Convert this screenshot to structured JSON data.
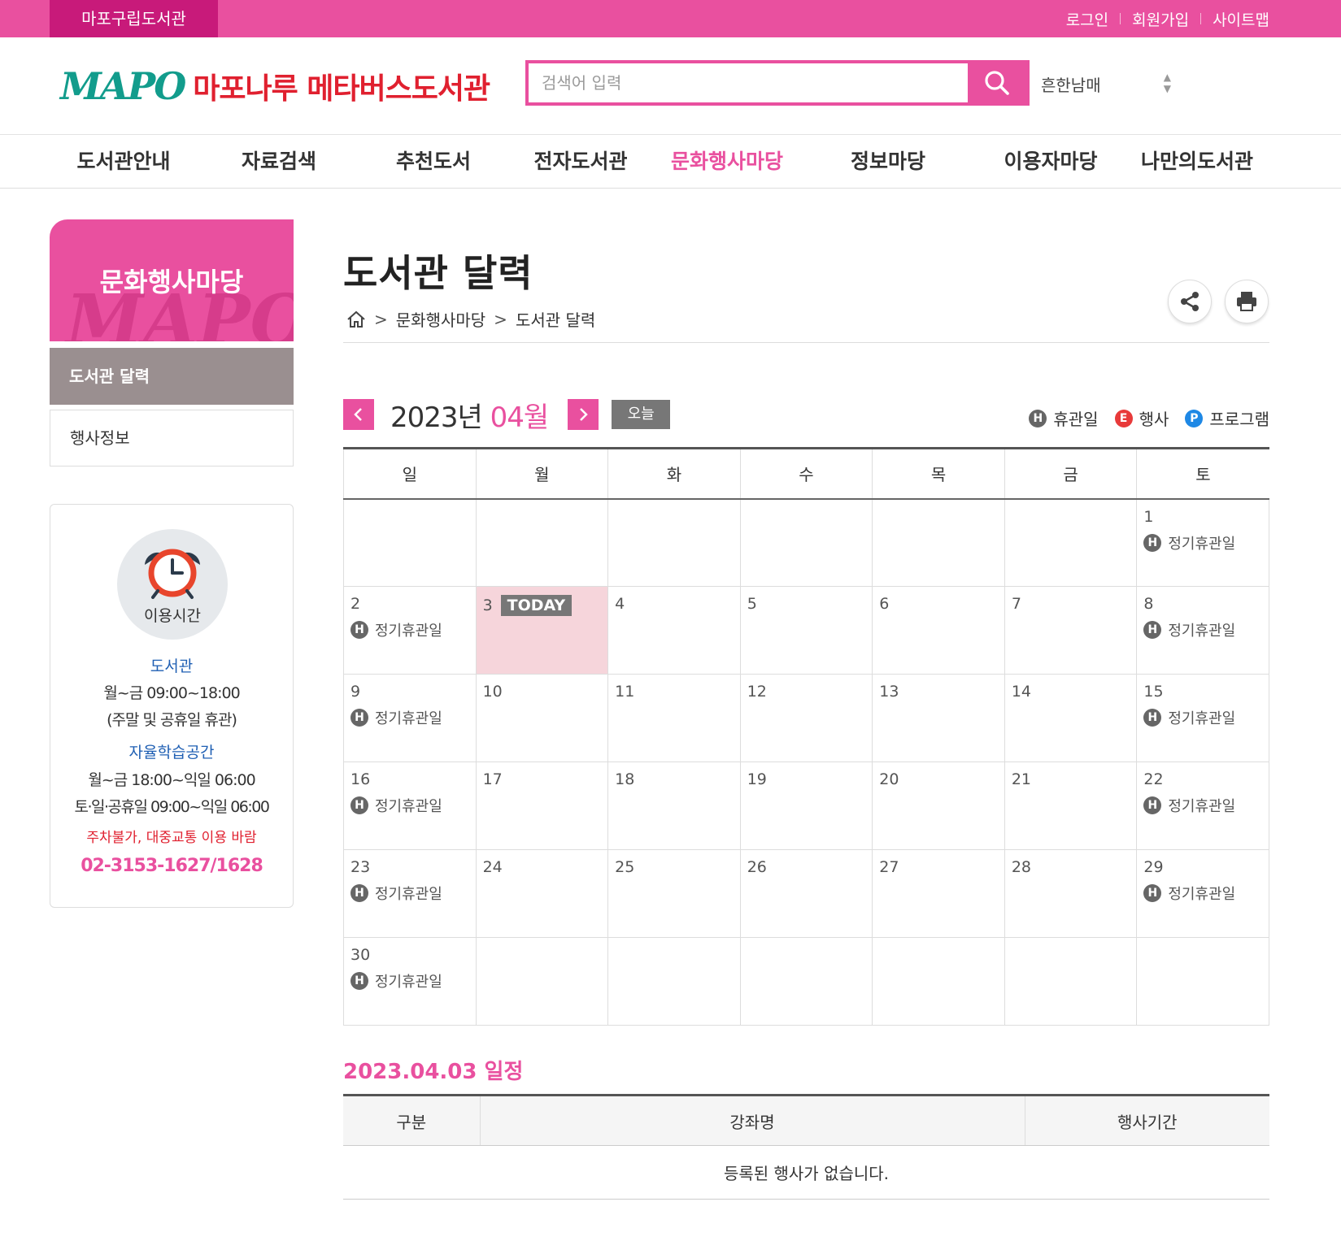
{
  "topbar": {
    "home_label": "마포구립도서관",
    "login": "로그인",
    "join": "회원가입",
    "sitemap": "사이트맵"
  },
  "header": {
    "logo_text": "MAPO",
    "library_name": "마포나루 메타버스도서관",
    "search_placeholder": "검색어 입력",
    "font_select": "흔한남매",
    "icons": [
      "search-icon",
      "sort-arrows-icon"
    ]
  },
  "gnb": [
    {
      "label": "도서관안내"
    },
    {
      "label": "자료검색"
    },
    {
      "label": "추천도서"
    },
    {
      "label": "전자도서관"
    },
    {
      "label": "문화행사마당",
      "active": true
    },
    {
      "label": "정보마당"
    },
    {
      "label": "이용자마당"
    },
    {
      "label": "나만의도서관"
    }
  ],
  "lnb": {
    "title": "문화행사마당",
    "items": [
      "도서관 달력",
      "행사정보"
    ]
  },
  "hours": {
    "label": "이용시간",
    "library_title": "도서관",
    "library_time": "월~금 09:00~18:00",
    "library_note": "(주말 및 공휴일 휴관)",
    "study_title": "자율학습공간",
    "study_time1": "월~금 18:00~익일 06:00",
    "study_time2": "토·일·공휴일 09:00~익일 06:00",
    "parking_note": "주차불가, 대중교통 이용 바람",
    "phone": "02-3153-1627/1628"
  },
  "page": {
    "title": "도서관 달력",
    "breadcrumb": [
      "문화행사마당",
      "도서관 달력"
    ],
    "icons": [
      "home-icon",
      "share-icon",
      "print-icon"
    ]
  },
  "calendar": {
    "year": "2023년",
    "month": "04월",
    "today_button": "오늘",
    "legend": [
      {
        "badge": "H",
        "label": "휴관일"
      },
      {
        "badge": "E",
        "label": "행사"
      },
      {
        "badge": "P",
        "label": "프로그램"
      }
    ],
    "weekdays": [
      "일",
      "월",
      "화",
      "수",
      "목",
      "금",
      "토"
    ],
    "today_tag": "TODAY",
    "holiday_label": "정기휴관일",
    "weeks": [
      [
        "",
        "",
        "",
        "",
        "",
        "",
        "1"
      ],
      [
        "2",
        "3",
        "4",
        "5",
        "6",
        "7",
        "8"
      ],
      [
        "9",
        "10",
        "11",
        "12",
        "13",
        "14",
        "15"
      ],
      [
        "16",
        "17",
        "18",
        "19",
        "20",
        "21",
        "22"
      ],
      [
        "23",
        "24",
        "25",
        "26",
        "27",
        "28",
        "29"
      ],
      [
        "30",
        "",
        "",
        "",
        "",
        "",
        ""
      ]
    ],
    "today": "3",
    "holidays": [
      "1",
      "2",
      "8",
      "9",
      "15",
      "16",
      "22",
      "23",
      "29",
      "30"
    ]
  },
  "schedule": {
    "title": "2023.04.03 일정",
    "columns": [
      "구분",
      "강좌명",
      "행사기간"
    ],
    "empty_message": "등록된 행사가 없습니다."
  },
  "colors": {
    "brand_pink": "#e9509f",
    "brand_dark_pink": "#c81a7a",
    "logo_green": "#129c8c",
    "logo_red": "#e0202f",
    "today_bg": "#f6d5db"
  }
}
